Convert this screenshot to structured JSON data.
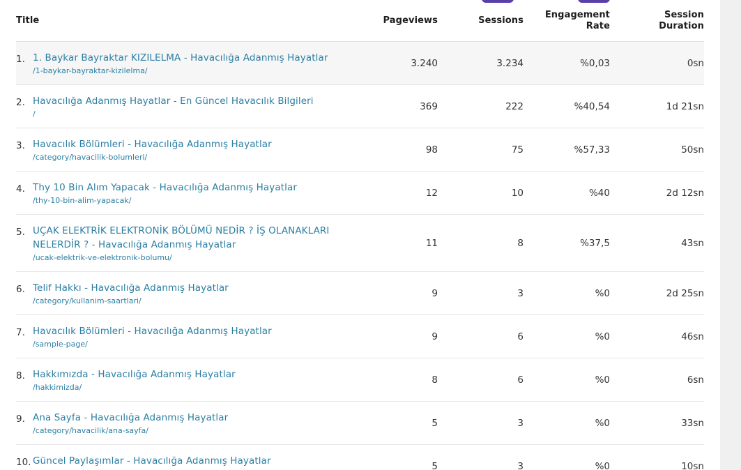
{
  "header": {
    "title": "Title",
    "pageviews": "Pageviews",
    "sessions": "Sessions",
    "engagement_line1": "Engagement",
    "engagement_line2": "Rate",
    "duration_line1": "Session",
    "duration_line2": "Duration"
  },
  "rows": [
    {
      "index": "1.",
      "title": "1. Baykar Bayraktar KIZILELMA - Havacılığa Adanmış Hayatlar",
      "path": "/1-baykar-bayraktar-kizilelma/",
      "pageviews": "3.240",
      "sessions": "3.234",
      "engagement": "%0,03",
      "duration": "0sn"
    },
    {
      "index": "2.",
      "title": "Havacılığa Adanmış Hayatlar - En Güncel Havacılık Bilgileri",
      "path": "/",
      "pageviews": "369",
      "sessions": "222",
      "engagement": "%40,54",
      "duration": "1d 21sn"
    },
    {
      "index": "3.",
      "title": "Havacılık Bölümleri - Havacılığa Adanmış Hayatlar",
      "path": "/category/havacilik-bolumleri/",
      "pageviews": "98",
      "sessions": "75",
      "engagement": "%57,33",
      "duration": "50sn"
    },
    {
      "index": "4.",
      "title": "Thy 10 Bin Alım Yapacak - Havacılığa Adanmış Hayatlar",
      "path": "/thy-10-bin-alim-yapacak/",
      "pageviews": "12",
      "sessions": "10",
      "engagement": "%40",
      "duration": "2d 12sn"
    },
    {
      "index": "5.",
      "title_line1": "UÇAK ELEKTRİK ELEKTRONİK BÖLÜMÜ NEDİR ? İŞ OLANAKLARI",
      "title_line2": "NELERDİR ? - Havacılığa Adanmış Hayatlar",
      "path": "/ucak-elektrik-ve-elektronik-bolumu/",
      "pageviews": "11",
      "sessions": "8",
      "engagement": "%37,5",
      "duration": "43sn"
    },
    {
      "index": "6.",
      "title": "Telif Hakkı - Havacılığa Adanmış Hayatlar",
      "path": "/category/kullanim-saartlari/",
      "pageviews": "9",
      "sessions": "3",
      "engagement": "%0",
      "duration": "2d 25sn"
    },
    {
      "index": "7.",
      "title": "Havacılık Bölümleri - Havacılığa Adanmış Hayatlar",
      "path": "/sample-page/",
      "pageviews": "9",
      "sessions": "6",
      "engagement": "%0",
      "duration": "46sn"
    },
    {
      "index": "8.",
      "title": "Hakkımızda - Havacılığa Adanmış Hayatlar",
      "path": "/hakkimizda/",
      "pageviews": "8",
      "sessions": "6",
      "engagement": "%0",
      "duration": "6sn"
    },
    {
      "index": "9.",
      "title": "Ana Sayfa - Havacılığa Adanmış Hayatlar",
      "path": "/category/havacilik/ana-sayfa/",
      "pageviews": "5",
      "sessions": "3",
      "engagement": "%0",
      "duration": "33sn"
    },
    {
      "index": "10.",
      "title": "Güncel Paylaşımlar - Havacılığa Adanmış Hayatlar",
      "path": "",
      "pageviews": "5",
      "sessions": "3",
      "engagement": "%0",
      "duration": "10sn"
    }
  ],
  "colors": {
    "link": "#2b7fa3",
    "accent_pill": "#5b3fa8",
    "row_highlight": "#f6f6f6"
  }
}
